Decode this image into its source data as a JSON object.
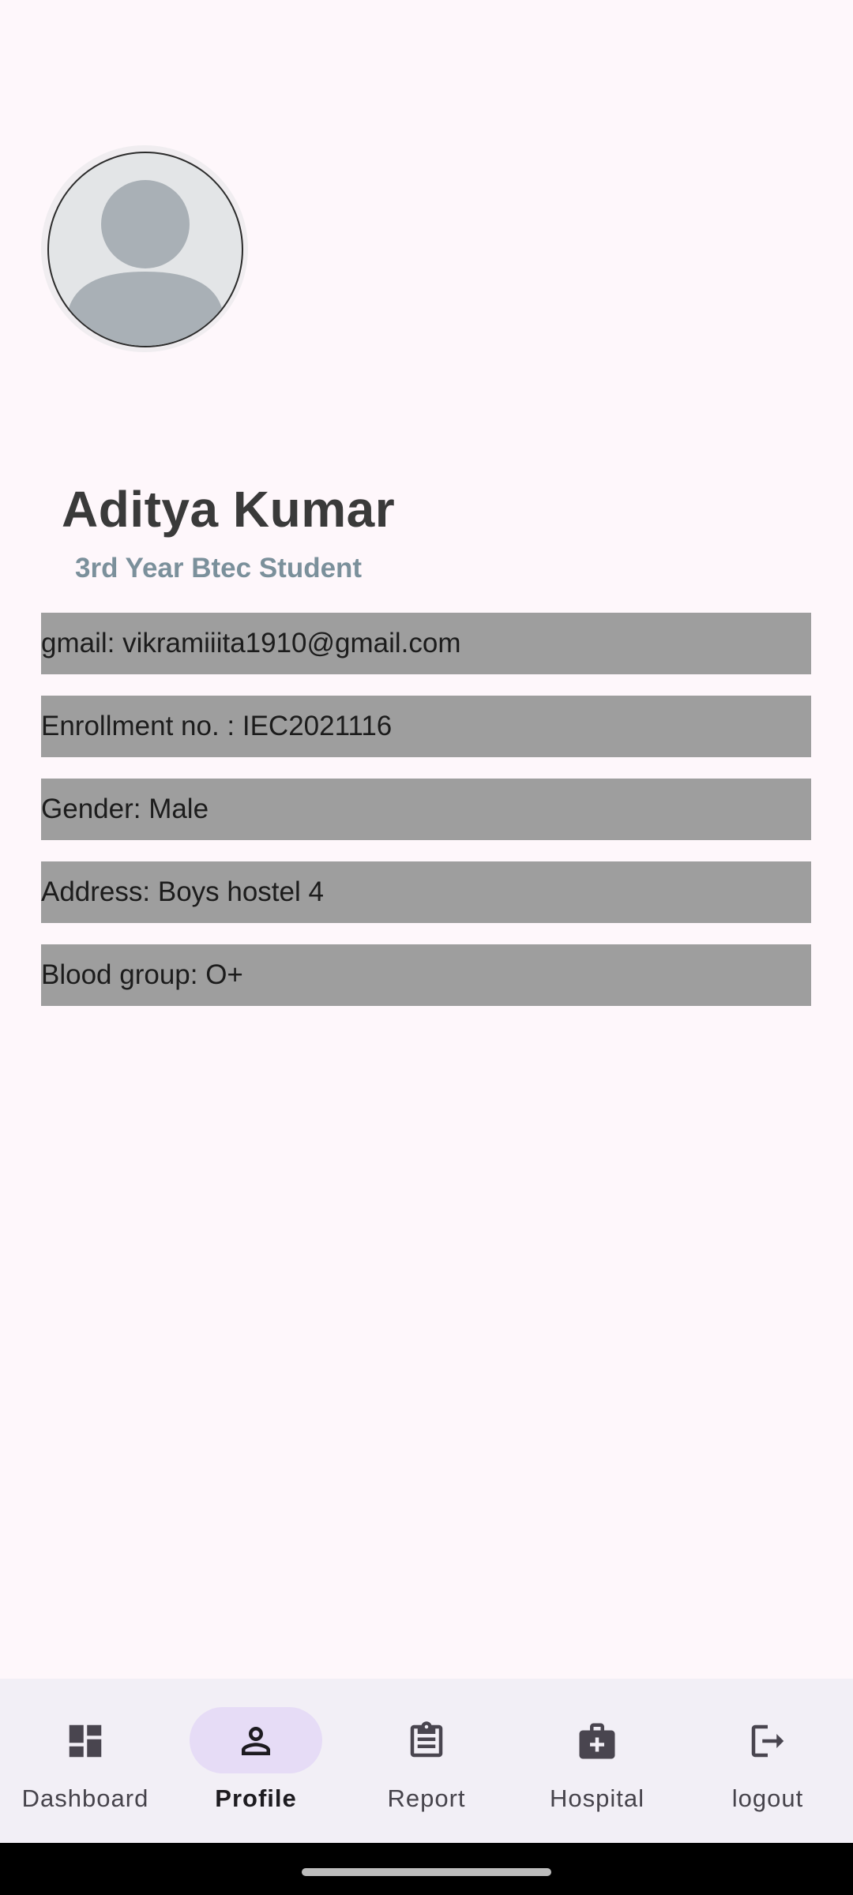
{
  "profile": {
    "name": "Aditya Kumar",
    "subtitle": "3rd Year Btec Student"
  },
  "info": [
    "gmail: vikramiiita1910@gmail.com",
    "Enrollment no. : IEC2021116",
    "Gender: Male",
    "Address: Boys hostel 4",
    "Blood group: O+"
  ],
  "nav": {
    "items": [
      {
        "label": "Dashboard",
        "icon": "dashboard-icon"
      },
      {
        "label": "Profile",
        "icon": "person-icon",
        "active": true
      },
      {
        "label": "Report",
        "icon": "clipboard-icon"
      },
      {
        "label": "Hospital",
        "icon": "medical-bag-icon"
      },
      {
        "label": "logout",
        "icon": "logout-icon"
      }
    ]
  },
  "colors": {
    "background": "#fef7fb",
    "info_row": "#9e9e9e",
    "subtitle": "#7b909b",
    "nav_background": "#f2eff6",
    "nav_active_pill": "#e6dcf6"
  }
}
